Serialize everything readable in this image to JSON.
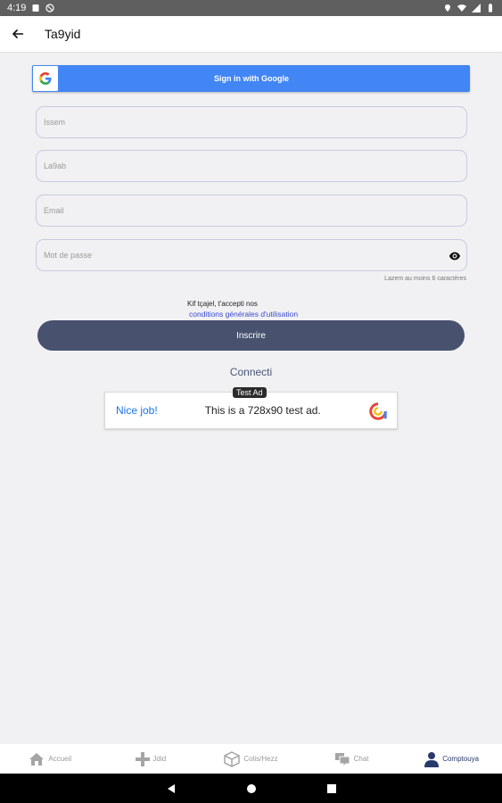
{
  "status_bar": {
    "time": "4:19"
  },
  "app_bar": {
    "title": "Ta9yid"
  },
  "google_button": {
    "label": "Sign in with Google"
  },
  "form": {
    "name_placeholder": "Issem",
    "lastname_placeholder": "La9ab",
    "email_placeholder": "Email",
    "password_placeholder": "Mot de passe",
    "password_hint": "Lazem au moins 6 caractères"
  },
  "terms": {
    "text": "Kif tçajel, t'accepti nos",
    "link": "conditions générales d'utilisation"
  },
  "submit_button": {
    "label": "Inscrire"
  },
  "connect_link": {
    "label": "Connecti"
  },
  "ad": {
    "badge": "Test Ad",
    "headline": "Nice job!",
    "text": "This is a 728x90 test ad."
  },
  "bottom_nav": {
    "items": [
      {
        "label": "Accueil",
        "icon": "home-icon"
      },
      {
        "label": "Jdid",
        "icon": "plus-icon"
      },
      {
        "label": "Colis/Hezz",
        "icon": "package-icon"
      },
      {
        "label": "Chat",
        "icon": "chat-icon"
      },
      {
        "label": "Comptouya",
        "icon": "person-icon",
        "active": true
      }
    ]
  },
  "colors": {
    "accent": "#48526e",
    "google_blue": "#4285f4",
    "link": "#3a4ad0"
  }
}
